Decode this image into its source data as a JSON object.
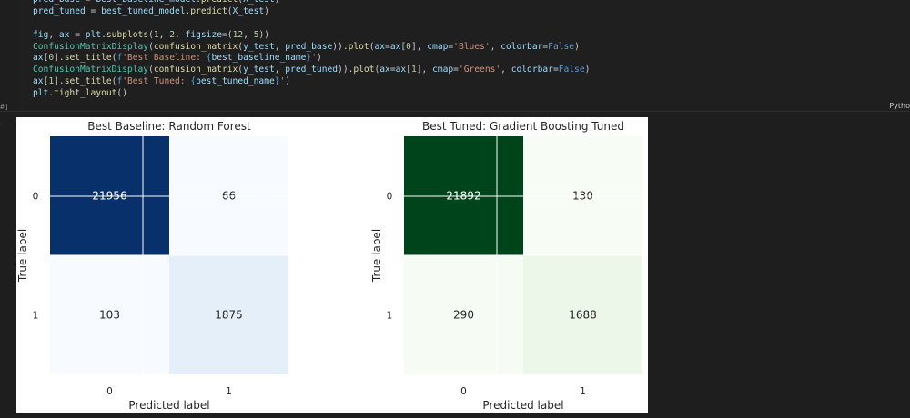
{
  "notebook": {
    "execution_count": "#]",
    "language": "Pytho",
    "gutter_mark": "-",
    "code_lines": [
      [
        {
          "t": "pred_base",
          "c": "var"
        },
        {
          "t": " = ",
          "c": ""
        },
        {
          "t": "best_baseline_model",
          "c": "var"
        },
        {
          "t": ".",
          "c": ""
        },
        {
          "t": "predict",
          "c": "fn"
        },
        {
          "t": "(",
          "c": ""
        },
        {
          "t": "X_test",
          "c": "var"
        },
        {
          "t": ")",
          "c": ""
        }
      ],
      [
        {
          "t": "pred_tuned",
          "c": "var"
        },
        {
          "t": " = ",
          "c": ""
        },
        {
          "t": "best_tuned_model",
          "c": "var"
        },
        {
          "t": ".",
          "c": ""
        },
        {
          "t": "predict",
          "c": "fn"
        },
        {
          "t": "(",
          "c": ""
        },
        {
          "t": "X_test",
          "c": "var"
        },
        {
          "t": ")",
          "c": ""
        }
      ],
      [],
      [
        {
          "t": "fig",
          "c": "var"
        },
        {
          "t": ", ",
          "c": ""
        },
        {
          "t": "ax",
          "c": "var"
        },
        {
          "t": " = ",
          "c": ""
        },
        {
          "t": "plt",
          "c": "var"
        },
        {
          "t": ".",
          "c": ""
        },
        {
          "t": "subplots",
          "c": "fn"
        },
        {
          "t": "(",
          "c": ""
        },
        {
          "t": "1",
          "c": "num"
        },
        {
          "t": ", ",
          "c": ""
        },
        {
          "t": "2",
          "c": "num"
        },
        {
          "t": ", ",
          "c": ""
        },
        {
          "t": "figsize",
          "c": "var"
        },
        {
          "t": "=(",
          "c": ""
        },
        {
          "t": "12",
          "c": "num"
        },
        {
          "t": ", ",
          "c": ""
        },
        {
          "t": "5",
          "c": "num"
        },
        {
          "t": "))",
          "c": ""
        }
      ],
      [
        {
          "t": "ConfusionMatrixDisplay",
          "c": "cls"
        },
        {
          "t": "(",
          "c": ""
        },
        {
          "t": "confusion_matrix",
          "c": "fn"
        },
        {
          "t": "(",
          "c": ""
        },
        {
          "t": "y_test",
          "c": "var"
        },
        {
          "t": ", ",
          "c": ""
        },
        {
          "t": "pred_base",
          "c": "var"
        },
        {
          "t": ")).",
          "c": ""
        },
        {
          "t": "plot",
          "c": "fn"
        },
        {
          "t": "(",
          "c": ""
        },
        {
          "t": "ax",
          "c": "var"
        },
        {
          "t": "=",
          "c": ""
        },
        {
          "t": "ax",
          "c": "var"
        },
        {
          "t": "[",
          "c": ""
        },
        {
          "t": "0",
          "c": "num"
        },
        {
          "t": "], ",
          "c": ""
        },
        {
          "t": "cmap",
          "c": "var"
        },
        {
          "t": "=",
          "c": ""
        },
        {
          "t": "'Blues'",
          "c": "str"
        },
        {
          "t": ", ",
          "c": ""
        },
        {
          "t": "colorbar",
          "c": "var"
        },
        {
          "t": "=",
          "c": ""
        },
        {
          "t": "False",
          "c": "kw"
        },
        {
          "t": ")",
          "c": ""
        }
      ],
      [
        {
          "t": "ax",
          "c": "var"
        },
        {
          "t": "[",
          "c": ""
        },
        {
          "t": "0",
          "c": "num"
        },
        {
          "t": "].",
          "c": ""
        },
        {
          "t": "set_title",
          "c": "fn"
        },
        {
          "t": "(",
          "c": ""
        },
        {
          "t": "f",
          "c": "kw"
        },
        {
          "t": "'Best Baseline: ",
          "c": "str"
        },
        {
          "t": "{",
          "c": "brace"
        },
        {
          "t": "best_baseline_name",
          "c": "var"
        },
        {
          "t": "}",
          "c": "brace"
        },
        {
          "t": "'",
          "c": "str"
        },
        {
          "t": ")",
          "c": ""
        }
      ],
      [
        {
          "t": "ConfusionMatrixDisplay",
          "c": "cls"
        },
        {
          "t": "(",
          "c": ""
        },
        {
          "t": "confusion_matrix",
          "c": "fn"
        },
        {
          "t": "(",
          "c": ""
        },
        {
          "t": "y_test",
          "c": "var"
        },
        {
          "t": ", ",
          "c": ""
        },
        {
          "t": "pred_tuned",
          "c": "var"
        },
        {
          "t": ")).",
          "c": ""
        },
        {
          "t": "plot",
          "c": "fn"
        },
        {
          "t": "(",
          "c": ""
        },
        {
          "t": "ax",
          "c": "var"
        },
        {
          "t": "=",
          "c": ""
        },
        {
          "t": "ax",
          "c": "var"
        },
        {
          "t": "[",
          "c": ""
        },
        {
          "t": "1",
          "c": "num"
        },
        {
          "t": "], ",
          "c": ""
        },
        {
          "t": "cmap",
          "c": "var"
        },
        {
          "t": "=",
          "c": ""
        },
        {
          "t": "'Greens'",
          "c": "str"
        },
        {
          "t": ", ",
          "c": ""
        },
        {
          "t": "colorbar",
          "c": "var"
        },
        {
          "t": "=",
          "c": ""
        },
        {
          "t": "False",
          "c": "kw"
        },
        {
          "t": ")",
          "c": ""
        }
      ],
      [
        {
          "t": "ax",
          "c": "var"
        },
        {
          "t": "[",
          "c": ""
        },
        {
          "t": "1",
          "c": "num"
        },
        {
          "t": "].",
          "c": ""
        },
        {
          "t": "set_title",
          "c": "fn"
        },
        {
          "t": "(",
          "c": ""
        },
        {
          "t": "f",
          "c": "kw"
        },
        {
          "t": "'Best Tuned: ",
          "c": "str"
        },
        {
          "t": "{",
          "c": "brace"
        },
        {
          "t": "best_tuned_name",
          "c": "var"
        },
        {
          "t": "}",
          "c": "brace"
        },
        {
          "t": "'",
          "c": "str"
        },
        {
          "t": ")",
          "c": ""
        }
      ],
      [
        {
          "t": "plt",
          "c": "var"
        },
        {
          "t": ".",
          "c": ""
        },
        {
          "t": "tight_layout",
          "c": "fn"
        },
        {
          "t": "()",
          "c": ""
        }
      ]
    ]
  },
  "chart_data": [
    {
      "type": "heatmap",
      "title": "Best Baseline: Random Forest",
      "xlabel": "Predicted label",
      "ylabel": "True label",
      "x_ticks": [
        "0",
        "1"
      ],
      "y_ticks": [
        "0",
        "1"
      ],
      "values": [
        [
          21956,
          66
        ],
        [
          103,
          1875
        ]
      ],
      "cmap": "Blues",
      "colors": {
        "high": "#08306b",
        "low": "#f7fbff",
        "mid": "#e3eef9"
      }
    },
    {
      "type": "heatmap",
      "title": "Best Tuned: Gradient Boosting Tuned",
      "xlabel": "Predicted label",
      "ylabel": "True label",
      "x_ticks": [
        "0",
        "1"
      ],
      "y_ticks": [
        "0",
        "1"
      ],
      "values": [
        [
          21892,
          130
        ],
        [
          290,
          1688
        ]
      ],
      "cmap": "Greens",
      "colors": {
        "high": "#00441b",
        "low": "#f7fcf5",
        "mid": "#eaf6e6"
      }
    }
  ]
}
